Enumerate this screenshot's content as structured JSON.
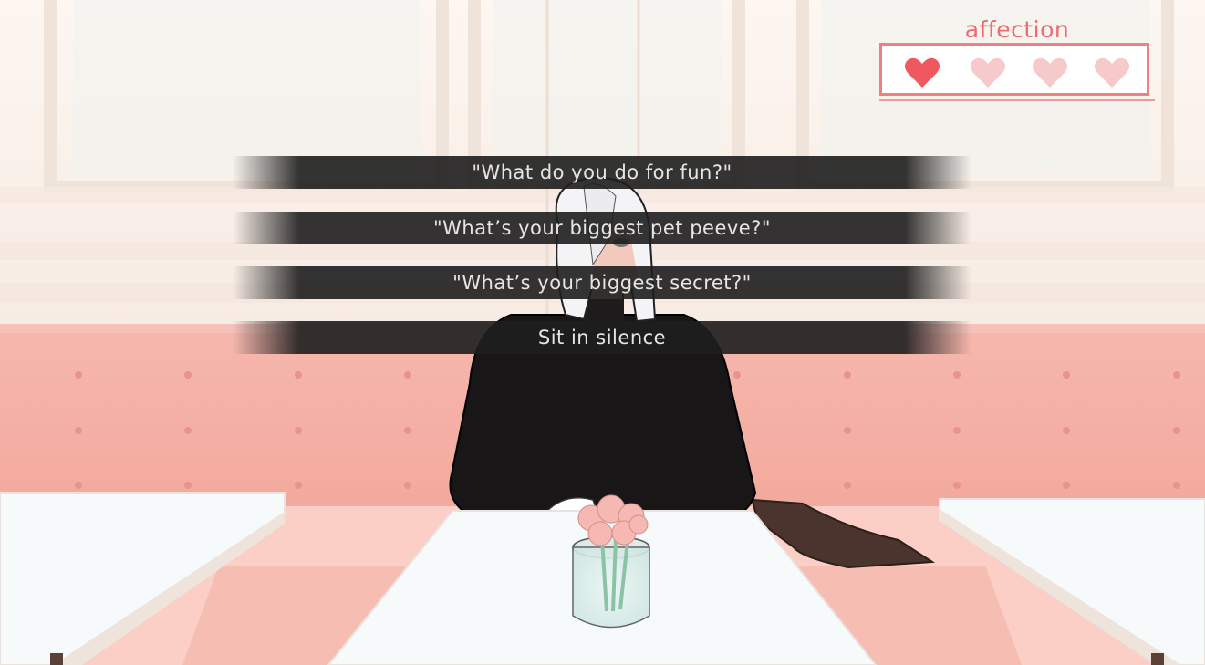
{
  "affection": {
    "title": "affection",
    "filled_hearts": 1,
    "total_hearts": 4,
    "colors": {
      "filled": "#f0585f",
      "empty": "#f6c9cb"
    }
  },
  "menu": {
    "choices": [
      "\"What do you do for fun?\"",
      "\"What’s your biggest pet peeve?\"",
      "\"What’s your biggest secret?\"",
      "Sit in silence"
    ]
  }
}
